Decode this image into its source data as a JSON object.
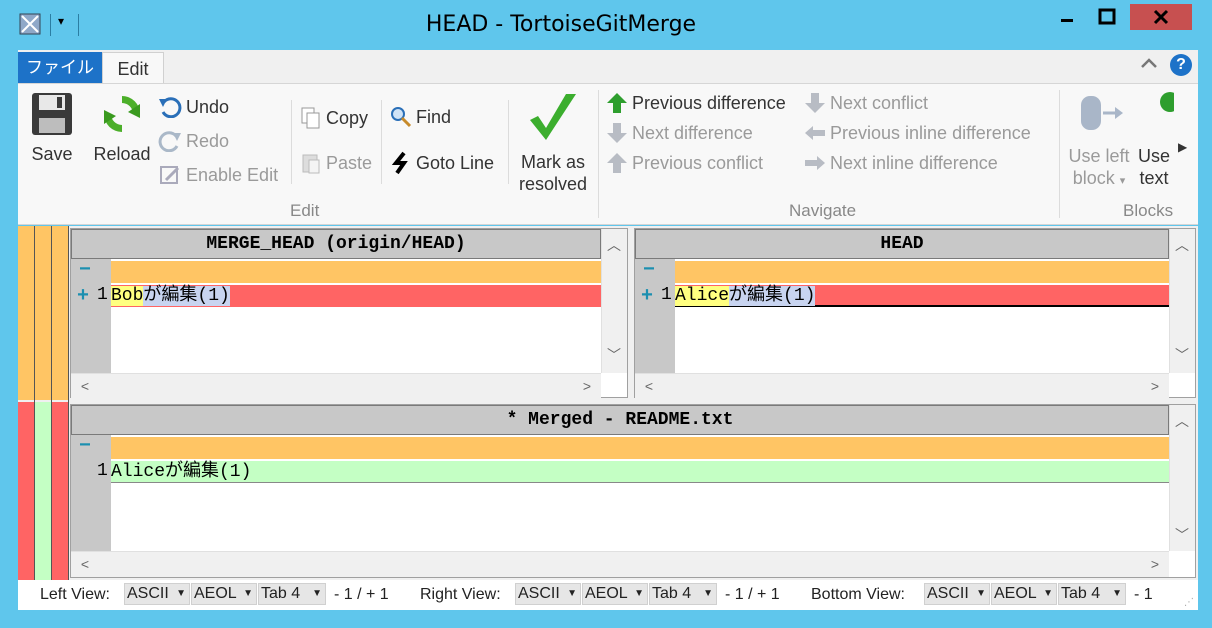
{
  "window": {
    "title": "HEAD - TortoiseGitMerge"
  },
  "ribbon_tabs": {
    "file": "ファイル",
    "edit": "Edit"
  },
  "ribbon": {
    "save": "Save",
    "reload": "Reload",
    "undo": "Undo",
    "redo": "Redo",
    "enable_edit": "Enable Edit",
    "copy": "Copy",
    "paste": "Paste",
    "find": "Find",
    "goto_line": "Goto Line",
    "mark_resolved_1": "Mark as",
    "mark_resolved_2": "resolved",
    "edit_group": "Edit",
    "prev_diff": "Previous difference",
    "next_diff": "Next difference",
    "prev_conflict": "Previous conflict",
    "next_conflict": "Next conflict",
    "prev_inline": "Previous inline difference",
    "next_inline": "Next inline difference",
    "navigate_group": "Navigate",
    "use_left_1": "Use left",
    "use_left_2": "block",
    "use_text_1": "Use",
    "use_text_2": "text",
    "blocks_group": "Blocks"
  },
  "panes": {
    "left": {
      "header": "MERGE_HEAD (origin/HEAD)",
      "marker": "+",
      "line_no": "1",
      "text_hl": "Bob",
      "text_rest": "が編集(1)"
    },
    "right": {
      "header": "HEAD",
      "marker": "+",
      "line_no": "1",
      "text_hl": "Alice",
      "text_rest": "が編集(1)"
    },
    "bottom": {
      "header": "* Merged - README.txt",
      "line_no": "1",
      "text": "Aliceが編集(1)"
    }
  },
  "status": {
    "left_label": "Left View:",
    "right_label": "Right View:",
    "bottom_label": "Bottom View:",
    "encoding": "ASCII",
    "eol": "AEOL",
    "tab": "Tab 4",
    "left_count": "- 1 / + 1",
    "right_count": "- 1 / + 1",
    "bottom_count": "- 1"
  },
  "colors": {
    "conflict_orange": "#ffc564",
    "removed_red": "#ff6464",
    "added_green": "#c4ffc4",
    "highlight_yellow": "#ffff80",
    "titlebar": "#5fc6ec"
  }
}
